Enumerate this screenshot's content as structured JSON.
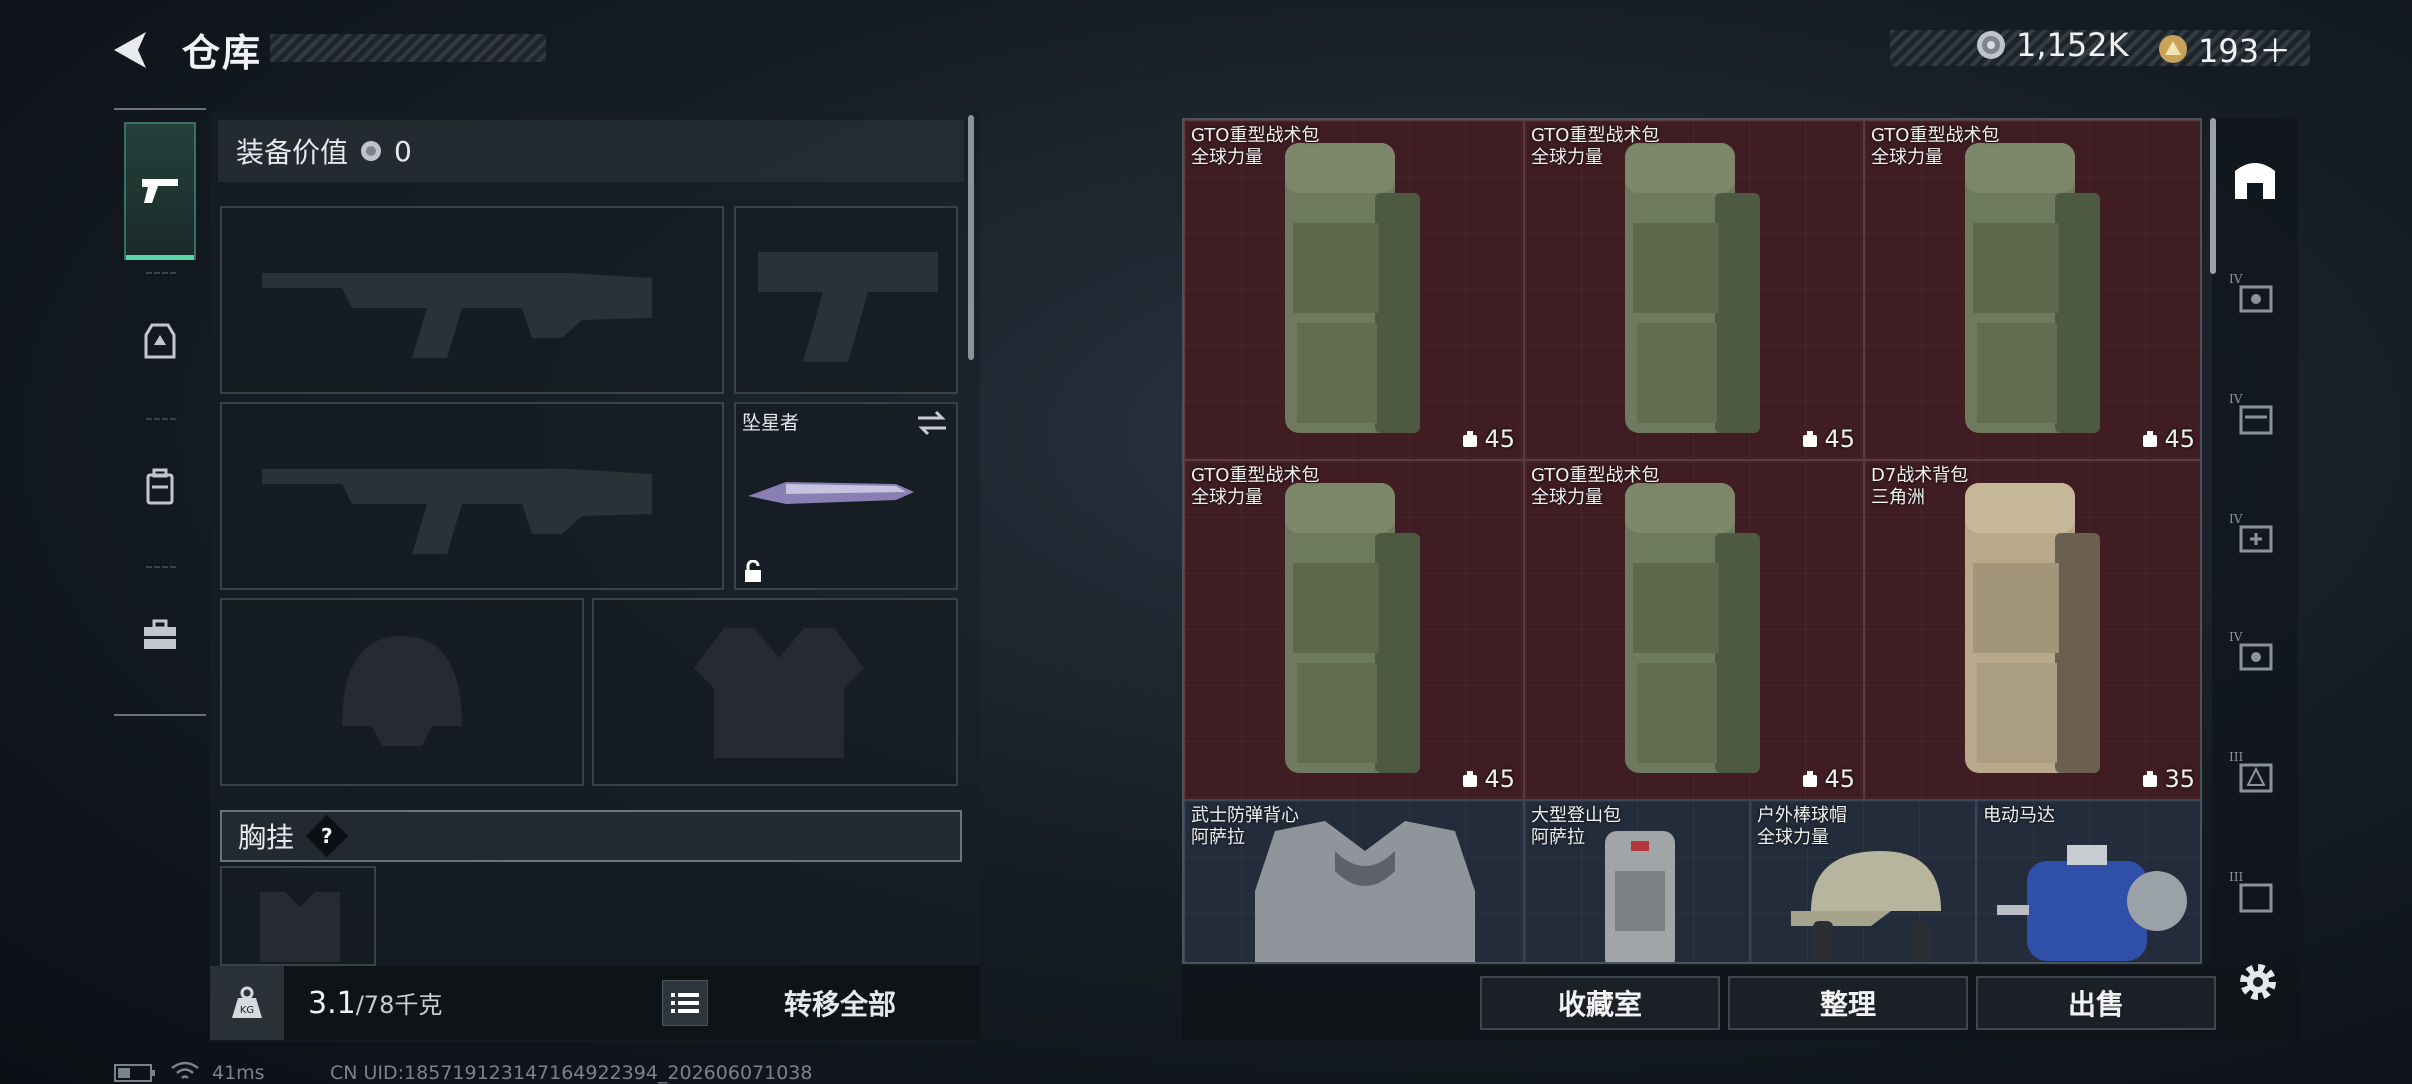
{
  "header": {
    "title": "仓库",
    "currency_silver": "1,152K",
    "currency_gold": "193＋"
  },
  "equipment": {
    "value_label": "装备价值",
    "value_amount": "0",
    "melee_slot_name": "坠星者",
    "chest_rig_label": "胸挂",
    "chest_rig_help": "?"
  },
  "footer_left": {
    "weight_value": "3.1",
    "weight_limit": "/78千克",
    "transfer_all": "转移全部"
  },
  "storage": {
    "items": [
      {
        "name": "GTO重型战术包",
        "origin": "全球力量",
        "capacity": "45"
      },
      {
        "name": "GTO重型战术包",
        "origin": "全球力量",
        "capacity": "45"
      },
      {
        "name": "GTO重型战术包",
        "origin": "全球力量",
        "capacity": "45"
      },
      {
        "name": "GTO重型战术包",
        "origin": "全球力量",
        "capacity": "45"
      },
      {
        "name": "GTO重型战术包",
        "origin": "全球力量",
        "capacity": "45"
      },
      {
        "name": "D7战术背包",
        "origin": "三角洲",
        "capacity": "35"
      },
      {
        "name": "武士防弹背心",
        "origin": "阿萨拉"
      },
      {
        "name": "大型登山包",
        "origin": "阿萨拉"
      },
      {
        "name": "户外棒球帽",
        "origin": "全球力量"
      },
      {
        "name": "电动马达",
        "origin": ""
      }
    ]
  },
  "filters": {
    "labels": [
      "IV",
      "IV",
      "IV",
      "IV",
      "III",
      "III"
    ]
  },
  "footer_right": {
    "collection_room": "收藏室",
    "organize": "整理",
    "sell": "出售"
  },
  "status_bar": {
    "ping": "41ms",
    "uid": "CN UID:18571912314716492239​4_202606071038"
  },
  "colors": {
    "accent_green": "#58d6a8",
    "backpack_cell": "#3f1d22",
    "item_cell_blue": "#232c3b"
  }
}
